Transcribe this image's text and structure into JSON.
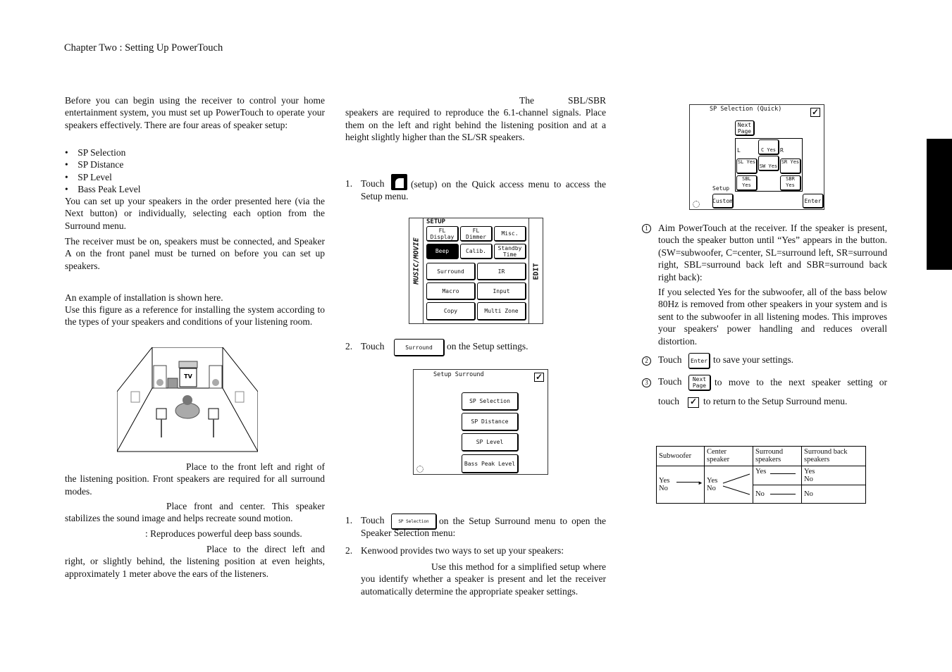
{
  "header": {
    "chapter": "Chapter Two : Setting Up PowerTouch"
  },
  "left": {
    "intro": "Before you can begin using the receiver to control your home entertainment system, you must set up PowerTouch to operate your speakers effectively. There are four areas of speaker setup:",
    "bullets": [
      "SP Selection",
      "SP Distance",
      "SP Level",
      "Bass Peak Level"
    ],
    "order": "You can set up your speakers in the order presented here (via the Next button) or individually, selecting each option from the Surround menu.",
    "receiver": "The receiver must be on, speakers must be connected, and Speaker A on the front panel must be turned on before you can set up speakers.",
    "example1": "An example of installation is shown here.",
    "example2": "Use this figure as a reference for installing the system according to the types of your speakers and conditions of your listening room.",
    "figure": {
      "tv_label": "TV"
    },
    "front": "Place to the front left and right of the listening position. Front speakers are required for all surround modes.",
    "center": "Place front and center. This speaker stabilizes the sound image and helps recreate sound motion.",
    "sub": ": Reproduces powerful deep bass sounds.",
    "surround": "Place to the direct left and right, or slightly behind, the listening position  at even heights, approximately 1 meter above the ears of the listeners."
  },
  "middle": {
    "sbl": "The SBL/SBR speakers are required to reproduce the 6.1-channel signals. Place them on the left and right behind the listening position and at a height slightly higher than the SL/SR speakers.",
    "step1_num": "1.",
    "step1_a": "Touch",
    "step1_b": "(setup) on the Quick access menu to access the Setup menu.",
    "setup_screen": {
      "title": "SETUP",
      "side_left": "MUSIC/MOVIE",
      "side_right": "EDIT",
      "buttons": [
        "FL Display",
        "FL Dimmer",
        "Misc.",
        "Beep",
        "Calib.",
        "Standby Time",
        "Surround",
        "IR",
        "Macro",
        "Input",
        "Copy",
        "Multi Zone"
      ]
    },
    "step2_num": "2.",
    "step2_a": "Touch",
    "step2_btn": "Surround",
    "step2_b": "on the Setup settings.",
    "surround_screen": {
      "title": "Setup Surround",
      "buttons": [
        "SP Selection",
        "SP Distance",
        "SP Level",
        "Bass Peak Level"
      ]
    },
    "stepB1_num": "1.",
    "stepB1_a": "Touch",
    "stepB1_btn": "SP Selection",
    "stepB1_b": "on the Setup Surround menu to open the Speaker Selection menu:",
    "stepB2_num": "2.",
    "stepB2": "Kenwood provides two ways to set up your speakers:",
    "quick": "Use this method for a simplified setup where you identify whether a speaker is present and let the receiver automatically determine the appropriate speaker settings."
  },
  "right": {
    "quick_screen": {
      "title": "SP Selection (Quick)",
      "next": "Next Page",
      "L": "L",
      "R": "R",
      "C": "C  Yes",
      "SW": "SW Yes",
      "SL": "SL  Yes",
      "SR": "SR  Yes",
      "SBL": "SBL Yes",
      "SBR": "SBR Yes",
      "setup": "Setup",
      "custom": "Custom",
      "enter": "Enter"
    },
    "item1": "Aim PowerTouch at the receiver. If the speaker is present, touch the speaker button until “Yes” appears in the button. (SW=subwoofer, C=center, SL=surround left, SR=surround right, SBL=surround back left and SBR=surround back right back):",
    "item1b": "If you selected Yes for the subwoofer, all of the bass below 80Hz is removed from other speakers in your system and is sent to the subwoofer in all listening modes. This improves your speakers' power handling and reduces overall distortion.",
    "item2_a": "Touch",
    "item2_btn": "Enter",
    "item2_b": "to save your settings.",
    "item3_a": "Touch",
    "item3_btn": "Next Page",
    "item3_b": "to move to the next speaker setting or",
    "item3_c": "touch",
    "item3_d": "to return to the Setup Surround menu.",
    "table": {
      "headers": [
        "Subwoofer",
        "Center speaker",
        "Surround speakers",
        "Surround back speakers"
      ],
      "sub": [
        "Yes",
        "No"
      ],
      "center": [
        "Yes",
        "No"
      ],
      "sur_yes": "Yes",
      "sur_no": "No",
      "back_yes": [
        "Yes",
        "No"
      ],
      "back_no": "No"
    }
  }
}
